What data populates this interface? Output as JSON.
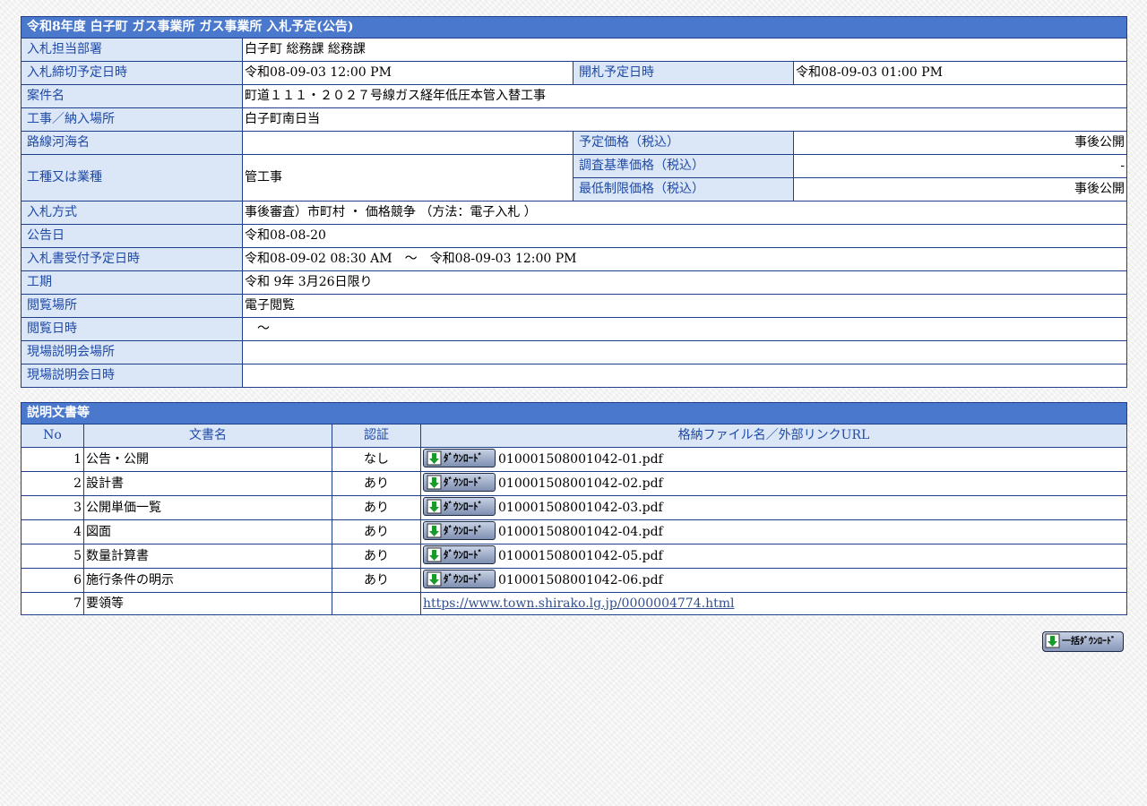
{
  "title": "令和8年度 白子町 ガス事業所 ガス事業所 入札予定(公告)",
  "info": {
    "dept_label": "入札担当部署",
    "dept_value": "白子町 総務課 総務課",
    "deadline_label": "入札締切予定日時",
    "deadline_value": "令和08-09-03 12:00 PM",
    "opening_label": "開札予定日時",
    "opening_value": "令和08-09-03 01:00 PM",
    "case_label": "案件名",
    "case_value": "町道１１１・２０２７号線ガス経年低圧本管入替工事",
    "place_label": "工事／納入場所",
    "place_value": "白子町南日当",
    "route_label": "路線河海名",
    "route_value": "",
    "planned_price_label": "予定価格（税込）",
    "planned_price_value": "事後公開",
    "type_label": "工種又は業種",
    "type_value": "管工事",
    "survey_price_label": "調査基準価格（税込）",
    "survey_price_value": "-",
    "min_price_label": "最低制限価格（税込）",
    "min_price_value": "事後公開",
    "method_label": "入札方式",
    "method_value": "事後審査）市町村 ・ 価格競争 （方法：電子入札 ）",
    "notice_label": "公告日",
    "notice_value": "令和08-08-20",
    "accept_label": "入札書受付予定日時",
    "accept_value": "令和08-09-02 08:30 AM　～　令和08-09-03 12:00 PM",
    "period_label": "工期",
    "period_value": "令和 9年 3月26日限り",
    "view_place_label": "閲覧場所",
    "view_place_value": "電子閲覧",
    "view_date_label": "閲覧日時",
    "view_date_value": "　～",
    "site_place_label": "現場説明会場所",
    "site_place_value": "",
    "site_date_label": "現場説明会日時",
    "site_date_value": ""
  },
  "docs": {
    "title": "説明文書等",
    "headers": {
      "no": "No",
      "name": "文書名",
      "auth": "認証",
      "file": "格納ファイル名／外部リンクURL"
    },
    "download_label": "ﾀﾞｳﾝﾛｰﾄﾞ",
    "rows": [
      {
        "no": "1",
        "name": "公告・公開",
        "auth": "なし",
        "file": "010001508001042-01.pdf"
      },
      {
        "no": "2",
        "name": "設計書",
        "auth": "あり",
        "file": "010001508001042-02.pdf"
      },
      {
        "no": "3",
        "name": "公開単価一覧",
        "auth": "あり",
        "file": "010001508001042-03.pdf"
      },
      {
        "no": "4",
        "name": "図面",
        "auth": "あり",
        "file": "010001508001042-04.pdf"
      },
      {
        "no": "5",
        "name": "数量計算書",
        "auth": "あり",
        "file": "010001508001042-05.pdf"
      },
      {
        "no": "6",
        "name": "施行条件の明示",
        "auth": "あり",
        "file": "010001508001042-06.pdf"
      }
    ],
    "link_row": {
      "no": "7",
      "name": "要領等",
      "auth": "",
      "url": "https://www.town.shirako.lg.jp/0000004774.html"
    }
  },
  "bulk_download_label": "一括ﾀﾞｳﾝﾛｰﾄﾞ",
  "colors": {
    "header_bg": "#4a78cc",
    "label_bg": "#dbe6f6",
    "label_text": "#1f4aa6",
    "border": "#1f3f8c"
  }
}
